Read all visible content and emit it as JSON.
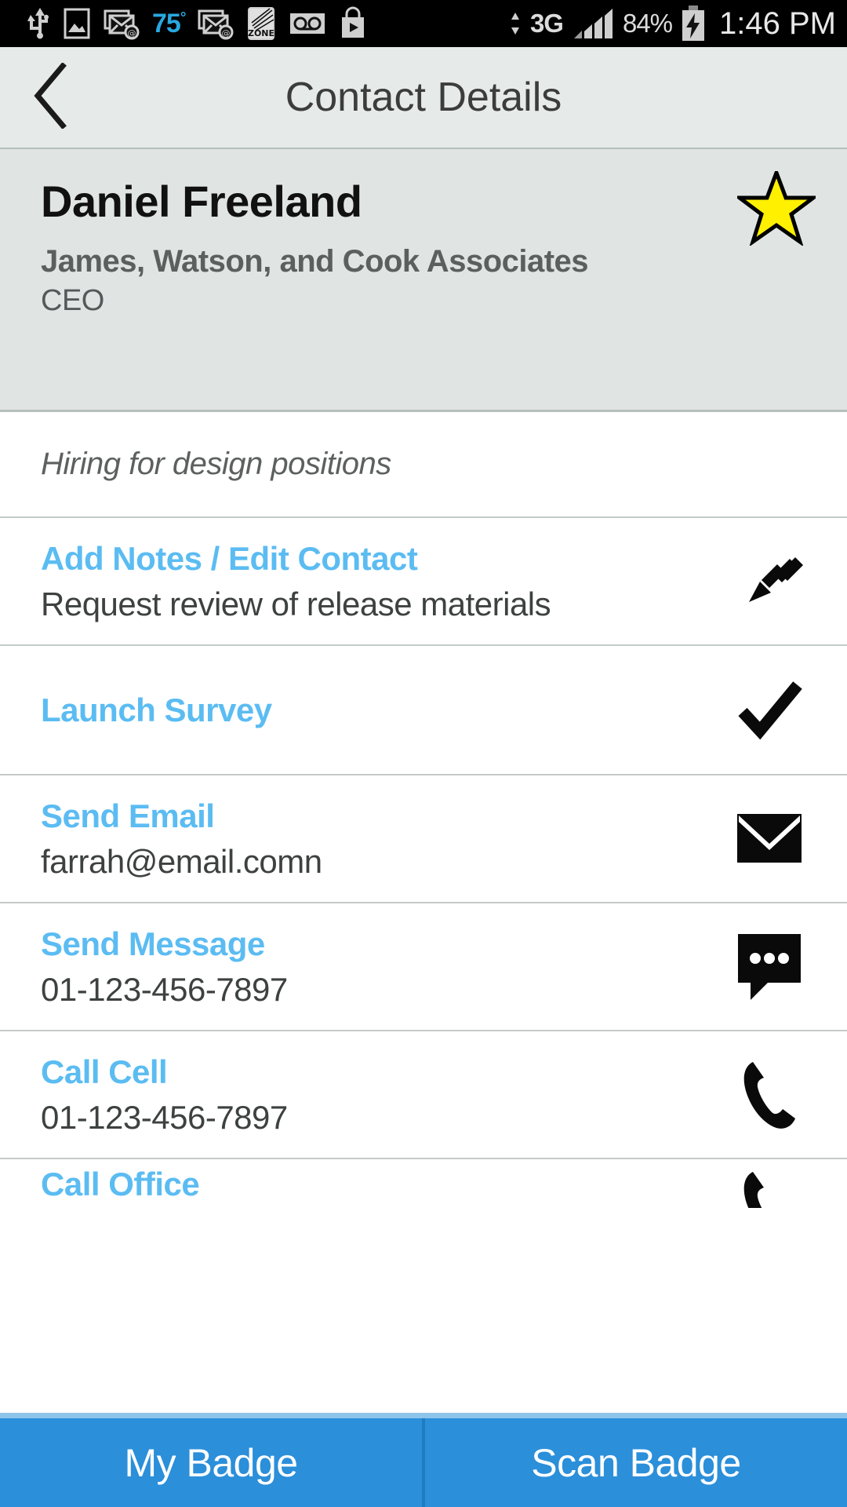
{
  "statusbar": {
    "icons": [
      "usb-icon",
      "gallery-icon",
      "email-at-icon",
      "email-at-icon-2",
      "zone-icon",
      "voicemail-icon",
      "play-store-icon"
    ],
    "temperature": "75",
    "temperature_unit": "°",
    "network": "3G",
    "battery_percent": "84%",
    "time": "1:46 PM"
  },
  "appbar": {
    "back_icon": "chevron-left-icon",
    "title": "Contact Details"
  },
  "contact": {
    "name": "Daniel Freeland",
    "company": "James, Watson, and Cook Associates",
    "job_title": "CEO",
    "favorite_icon": "star-icon",
    "favorite_color": "#fff000"
  },
  "note": {
    "text": "Hiring for design positions"
  },
  "rows": [
    {
      "label": "Add Notes / Edit Contact",
      "sub": "Request review of release materials",
      "icon": "pencil-icon",
      "name": "row-add-notes-edit-contact"
    },
    {
      "label": "Launch Survey",
      "sub": "",
      "icon": "check-icon",
      "name": "row-launch-survey"
    },
    {
      "label": "Send Email",
      "sub": "farrah@email.comn",
      "icon": "envelope-icon",
      "name": "row-send-email"
    },
    {
      "label": "Send Message",
      "sub": "01-123-456-7897",
      "icon": "message-bubble-icon",
      "name": "row-send-message"
    },
    {
      "label": "Call Cell",
      "sub": "01-123-456-7897",
      "icon": "phone-icon",
      "name": "row-call-cell"
    },
    {
      "label": "Call Office",
      "sub": "",
      "icon": "phone-icon",
      "name": "row-call-office"
    }
  ],
  "bottombar": {
    "my_badge": "My Badge",
    "scan_badge": "Scan Badge",
    "accent_color": "#2b8fda"
  },
  "theme": {
    "link_blue": "#5bbcf2",
    "header_gray": "#e6eae9",
    "contact_gray": "#e0e4e3"
  }
}
